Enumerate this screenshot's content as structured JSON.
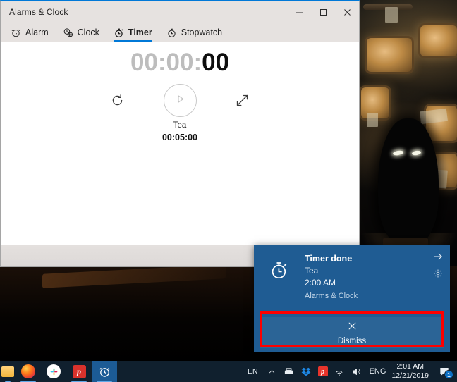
{
  "window": {
    "title": "Alarms & Clock",
    "controls": {
      "minimize": "minimize-button",
      "maximize": "maximize-button",
      "close": "close-button"
    },
    "tabs": [
      {
        "label": "Alarm",
        "icon": "alarm-clock-icon",
        "selected": false
      },
      {
        "label": "Clock",
        "icon": "world-clock-icon",
        "selected": false
      },
      {
        "label": "Timer",
        "icon": "timer-icon",
        "selected": true
      },
      {
        "label": "Stopwatch",
        "icon": "stopwatch-icon",
        "selected": false
      }
    ],
    "accent_color": "#0078d7"
  },
  "timer": {
    "digits_inactive": "00:00:",
    "digits_active": "00",
    "reset_icon": "reset-icon",
    "play_icon": "play-icon",
    "expand_icon": "expand-icon",
    "name": "Tea",
    "preset": "00:05:00"
  },
  "appbar": {
    "add_label": "+"
  },
  "toast": {
    "title": "Timer done",
    "subtitle": "Tea",
    "time": "2:00 AM",
    "app": "Alarms & Clock",
    "icon": "stopwatch-icon",
    "arrow_icon": "arrow-right-icon",
    "settings_icon": "gear-icon",
    "dismiss_label": "Dismiss",
    "dismiss_icon": "close-icon",
    "background_color": "#1f5c93",
    "highlight_color": "#fe0000"
  },
  "taskbar": {
    "apps": [
      {
        "name": "file-explorer",
        "label": "",
        "running": true
      },
      {
        "name": "firefox",
        "label": "",
        "running": true
      },
      {
        "name": "slack",
        "label": "",
        "running": false
      },
      {
        "name": "pdf-app",
        "label": "p",
        "running": true
      },
      {
        "name": "alarms-and-clock",
        "label": "",
        "running": true,
        "active": true
      }
    ],
    "tray": {
      "input_indicator": "EN",
      "chevron_icon": "show-hidden-icons-icon",
      "icons": [
        "printer-icon",
        "dropbox-icon",
        "pdf-tray-icon",
        "network-icon",
        "volume-icon"
      ],
      "language": "ENG",
      "time": "2:01 AM",
      "date": "12/21/2019",
      "action_center_icon": "action-center-icon",
      "action_center_badge": "1"
    }
  }
}
